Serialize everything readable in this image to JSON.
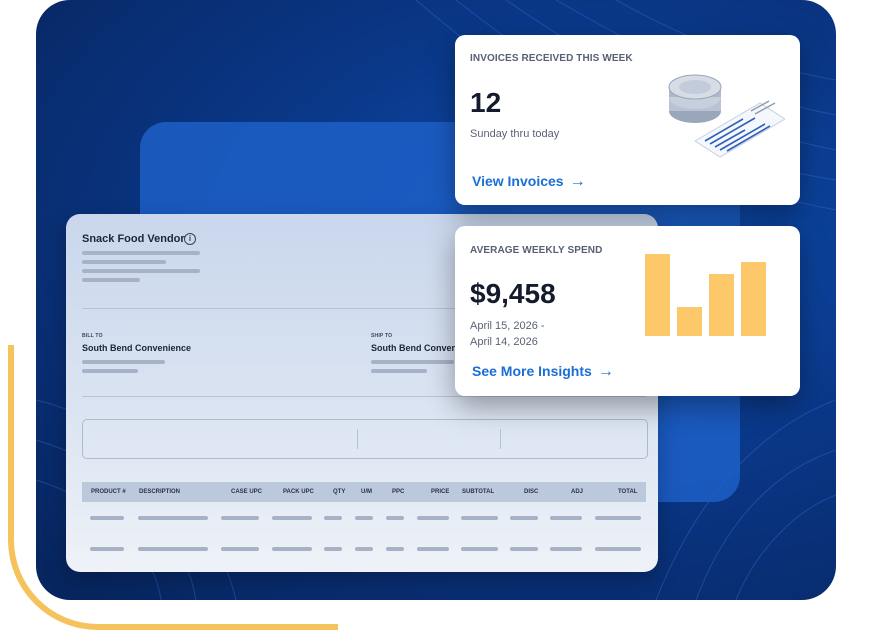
{
  "invoice": {
    "vendor_name": "Snack Food Vendor",
    "info_icon": "i",
    "bill_to_label": "BILL TO",
    "bill_to_name": "South Bend Convenience",
    "ship_to_label": "SHIP TO",
    "ship_to_name": "South Bend Convenience",
    "columns": [
      "PRODUCT #",
      "DESCRIPTION",
      "CASE UPC",
      "PACK UPC",
      "QTY",
      "U/M",
      "PPC",
      "PRICE",
      "SUBTOTAL",
      "DISC",
      "ADJ",
      "TOTAL"
    ]
  },
  "invoices_card": {
    "label": "INVOICES RECEIVED THIS WEEK",
    "value": "12",
    "sub": "Sunday thru today",
    "link": "View Invoices",
    "arrow_icon": "→"
  },
  "spend_card": {
    "label": "AVERAGE WEEKLY SPEND",
    "value": "$9,458",
    "date_line1": "April 15, 2026 -",
    "date_line2": "April 14, 2026",
    "link": "See More Insights",
    "arrow_icon": "→",
    "bar_levels": [
      1.0,
      0.35,
      0.75,
      0.9
    ]
  },
  "colors": {
    "accent_yellow": "#f5c25c",
    "brand_blue": "#0a3787",
    "link_blue": "#1a6fd4",
    "bar_yellow": "#fdc86a"
  }
}
